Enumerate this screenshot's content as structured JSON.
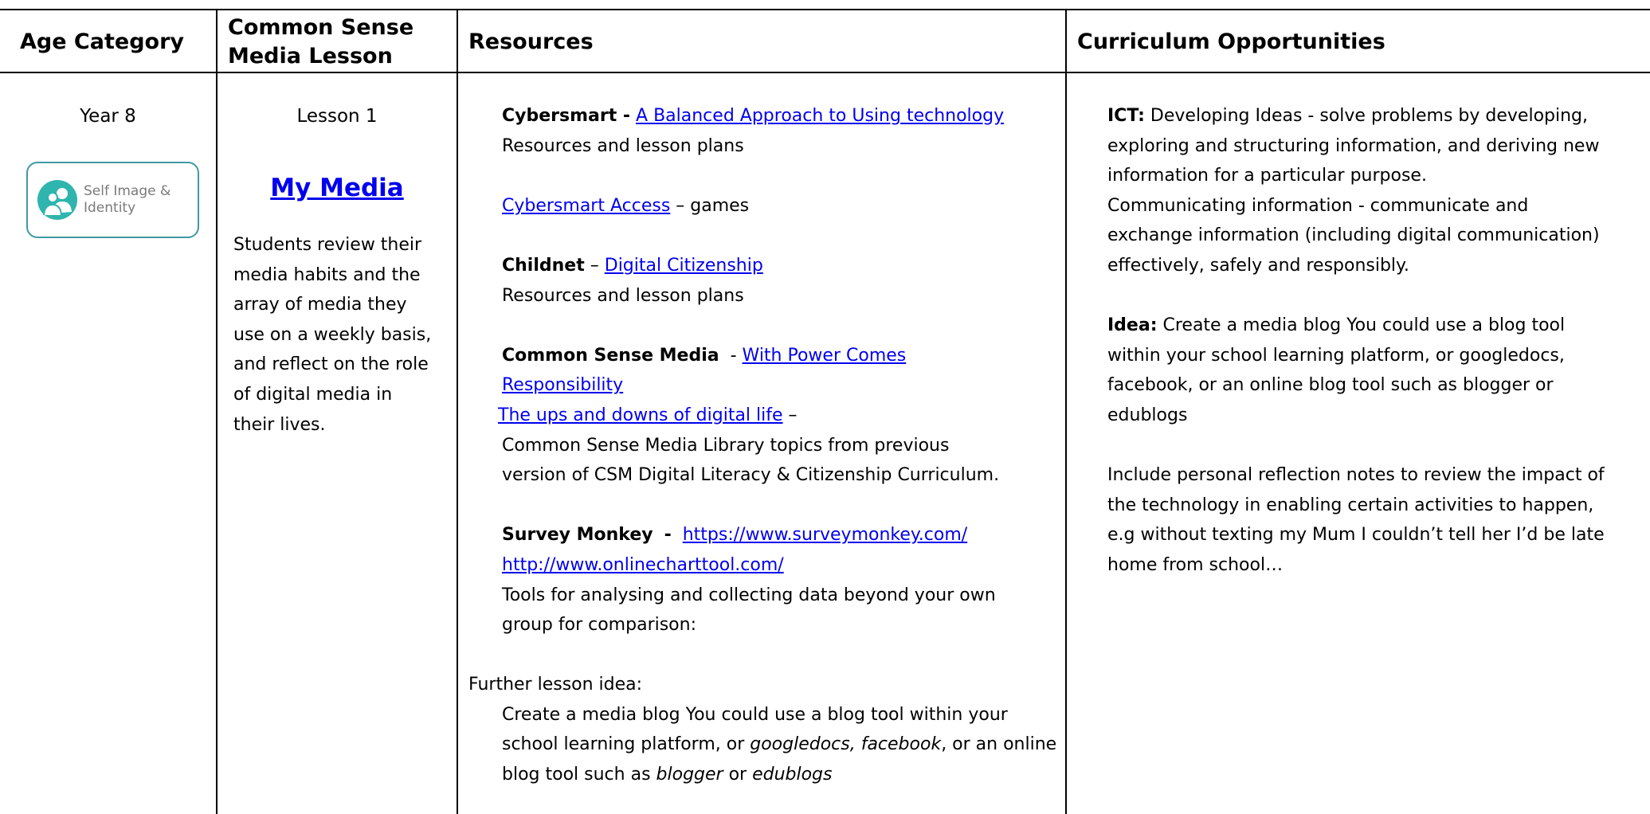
{
  "headers": {
    "age": "Age Category",
    "lesson_line1": "Common Sense",
    "lesson_line2": "Media Lesson",
    "resources": "Resources",
    "curriculum": "Curriculum Opportunities"
  },
  "age": {
    "value": "Year 8",
    "badge_line1": "Self Image &",
    "badge_line2": "Identity",
    "badge_icon": "people-icon"
  },
  "lesson": {
    "number": "Lesson 1",
    "title": "My Media",
    "desc_lines": [
      "Students review their",
      "media habits and the",
      "array of media they",
      "use on a weekly basis,",
      "and reflect on the role",
      "of digital media in",
      "their lives."
    ]
  },
  "resources": {
    "cybersmart_label": "Cybersmart -",
    "cybersmart_link": "A Balanced Approach to Using technology",
    "cybersmart_note": "Resources and lesson plans",
    "access_link": "Cybersmart Access",
    "access_note": "– games",
    "childnet_label": "Childnet",
    "childnet_dash": "–",
    "childnet_link": "Digital Citizenship",
    "childnet_note": "Resources and lesson plans",
    "csm_label": "Common Sense Media",
    "csm_dash": "-",
    "csm_link_line1": "With Power Comes",
    "csm_link_line2": "Responsibility",
    "ups_link": "The ups and downs of digital life",
    "ups_dash": "–",
    "csm_note_line1": "Common Sense Media Library topics from previous",
    "csm_note_line2": "version of CSM Digital Literacy & Citizenship Curriculum.",
    "survey_label": "Survey Monkey",
    "survey_dash": "-",
    "survey_link": "https://www.surveymonkey.com/",
    "chart_link": "http://www.onlinecharttool.com/",
    "tools_line1": "Tools for analysing and collecting data beyond your own",
    "tools_line2": "group for comparison:",
    "further_label": "Further lesson idea:",
    "further_line1": "Create a media blog You could use a blog tool within your",
    "further_line2_a": "school learning platform, or ",
    "further_line2_b": "googledocs, facebook",
    "further_line2_c": ", or an online",
    "further_line3_a": "blog tool such as ",
    "further_line3_b": "blogger",
    "further_line3_c": " or ",
    "further_line3_d": "edublogs"
  },
  "curriculum": {
    "ict_label": "ICT:",
    "ict_line1": " Developing Ideas - solve problems by developing,",
    "ict_lines": [
      "exploring and structuring information, and deriving new",
      "information for a particular purpose.",
      "Communicating information - communicate and",
      "exchange information (including digital communication)",
      "effectively, safely and responsibly."
    ],
    "idea_label": "Idea:",
    "idea_line1": " Create a media blog You could use a blog tool",
    "idea_lines": [
      "within your school learning platform, or googledocs,",
      "facebook, or an online blog tool such as blogger or",
      "edublogs"
    ],
    "reflect_lines": [
      "Include personal reflection notes to review the impact of",
      "the technology in enabling certain activities to happen,",
      "e.g without texting my Mum I couldn’t tell her I’d be late",
      "home from school…"
    ]
  }
}
